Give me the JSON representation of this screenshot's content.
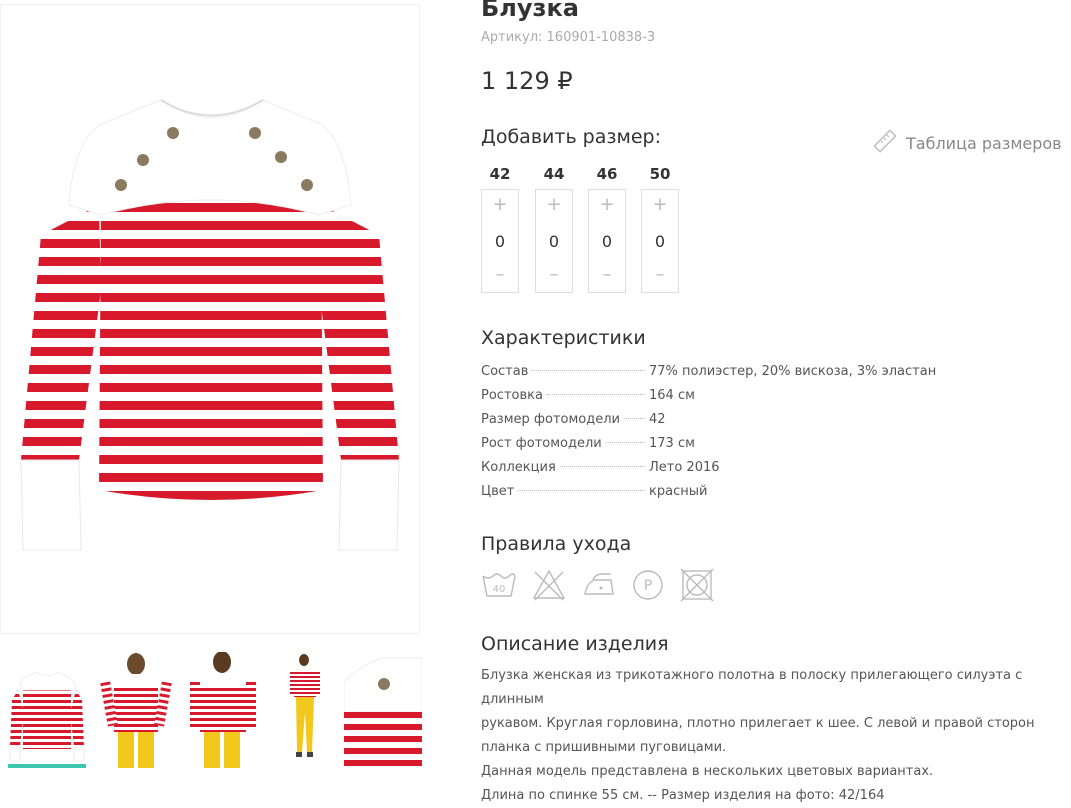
{
  "product": {
    "title": "Блузка",
    "article": "Артикул: 160901-10838-3",
    "price": "1 129 ₽"
  },
  "sizes": {
    "heading": "Добавить размер:",
    "table_link": "Таблица размеров",
    "items": [
      {
        "size": "42",
        "qty": "0"
      },
      {
        "size": "44",
        "qty": "0"
      },
      {
        "size": "46",
        "qty": "0"
      },
      {
        "size": "50",
        "qty": "0"
      }
    ],
    "plus": "+",
    "minus": "–"
  },
  "characteristics": {
    "heading": "Характеристики",
    "rows": [
      {
        "key": "Состав",
        "value": "77% полиэстер, 20% вискоза, 3% эластан"
      },
      {
        "key": "Ростовка",
        "value": "164 см"
      },
      {
        "key": "Размер фотомодели",
        "value": "42"
      },
      {
        "key": "Рост фотомодели",
        "value": "173 см"
      },
      {
        "key": "Коллекция",
        "value": "Лето 2016"
      },
      {
        "key": "Цвет",
        "value": "красный"
      }
    ]
  },
  "care": {
    "heading": "Правила ухода",
    "icons": [
      "wash-40-icon",
      "no-bleach-icon",
      "iron-icon",
      "dry-clean-p-icon",
      "no-tumble-dry-icon"
    ],
    "wash_temp": "40"
  },
  "description": {
    "heading": "Описание изделия",
    "lines": [
      "Блузка женская из трикотажного полотна в полоску прилегающего силуэта с длинным",
      "рукавом. Круглая горловина, плотно прилегает к шее. С левой и правой сторон",
      "планка с пришивными пуговицами.",
      "Данная модель представлена в нескольких цветовых вариантах.",
      "Длина по спинке 55 см. -- Размер изделия на фото: 42/164"
    ]
  },
  "colors": {
    "stripe_red": "#d8192c",
    "accent_teal": "#3ec7b0"
  }
}
